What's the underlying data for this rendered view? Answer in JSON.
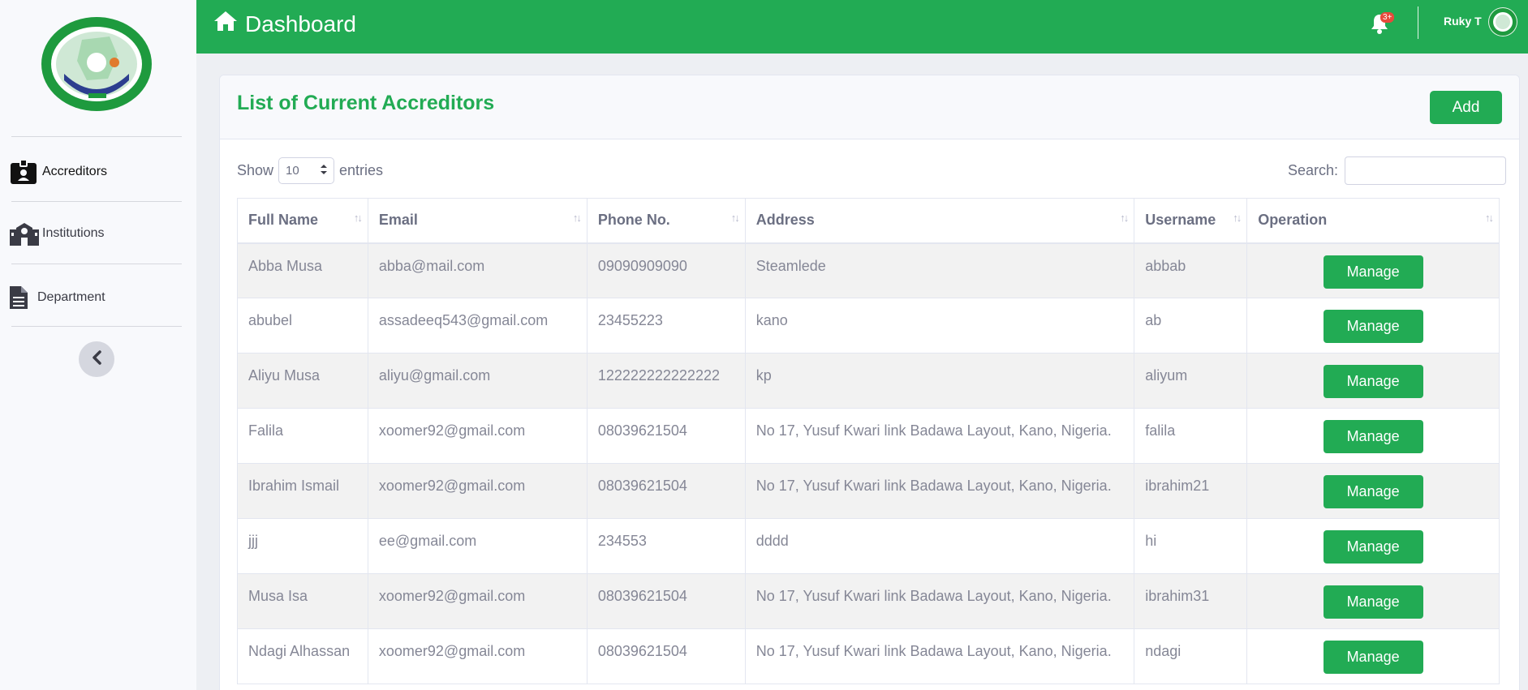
{
  "sidebar": {
    "items": [
      {
        "label": "Accreditors",
        "icon": "id-badge-icon"
      },
      {
        "label": "Institutions",
        "icon": "school-icon"
      },
      {
        "label": "Department",
        "icon": "document-icon"
      }
    ]
  },
  "topbar": {
    "title": "Dashboard",
    "notification_badge": "3+",
    "user_name": "Ruky T"
  },
  "card": {
    "title": "List of Current Accreditors",
    "add_label": "Add",
    "show_label": "Show",
    "entries_value": "10",
    "entries_label": "entries",
    "search_label": "Search:",
    "search_value": ""
  },
  "table": {
    "columns": [
      "Full Name",
      "Email",
      "Phone No.",
      "Address",
      "Username",
      "Operation"
    ],
    "action_label": "Manage",
    "rows": [
      {
        "name": "Abba Musa",
        "email": "abba@mail.com",
        "phone": "09090909090",
        "address": "Steamlede",
        "username": "abbab"
      },
      {
        "name": "abubel",
        "email": "assadeeq543@gmail.com",
        "phone": "23455223",
        "address": "kano",
        "username": "ab"
      },
      {
        "name": "Aliyu Musa",
        "email": "aliyu@gmail.com",
        "phone": "122222222222222",
        "address": "kp",
        "username": "aliyum"
      },
      {
        "name": "Falila",
        "email": "xoomer92@gmail.com",
        "phone": "08039621504",
        "address": "No 17, Yusuf Kwari link Badawa Layout, Kano, Nigeria.",
        "username": "falila"
      },
      {
        "name": "Ibrahim Ismail",
        "email": "xoomer92@gmail.com",
        "phone": "08039621504",
        "address": "No 17, Yusuf Kwari link Badawa Layout, Kano, Nigeria.",
        "username": "ibrahim21"
      },
      {
        "name": "jjj",
        "email": "ee@gmail.com",
        "phone": "234553",
        "address": "dddd",
        "username": "hi"
      },
      {
        "name": "Musa Isa",
        "email": "xoomer92@gmail.com",
        "phone": "08039621504",
        "address": "No 17, Yusuf Kwari link Badawa Layout, Kano, Nigeria.",
        "username": "ibrahim31"
      },
      {
        "name": "Ndagi Alhassan",
        "email": "xoomer92@gmail.com",
        "phone": "08039621504",
        "address": "No 17, Yusuf Kwari link Badawa Layout, Kano, Nigeria.",
        "username": "ndagi"
      }
    ]
  },
  "colors": {
    "brand": "#22ab54",
    "badge": "#e74a3b"
  }
}
